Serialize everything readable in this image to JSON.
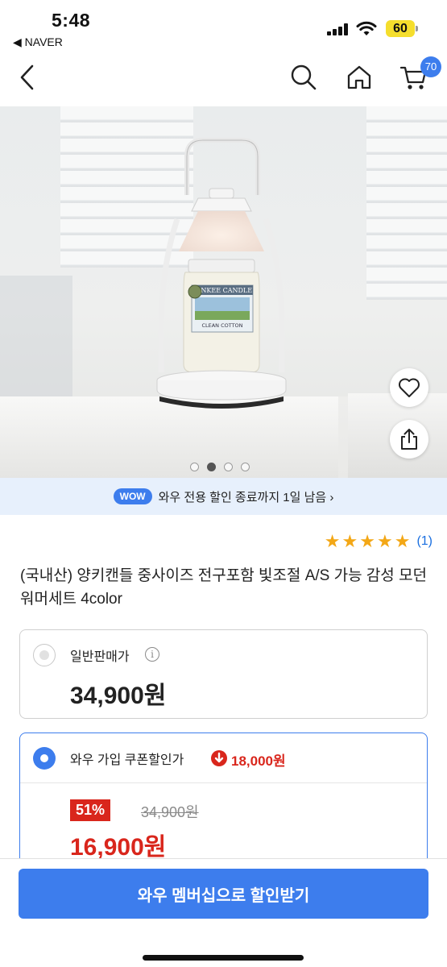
{
  "status_bar": {
    "time": "5:48",
    "back_app": "◀ NAVER",
    "battery": "60",
    "battery_color": "#f5de2d"
  },
  "nav": {
    "icons": [
      "back-icon",
      "search-icon",
      "home-icon",
      "cart-icon"
    ],
    "cart_count": "70"
  },
  "gallery": {
    "page_count": 4,
    "active_page": 2,
    "image_text": [
      "YANKEE CANDLE",
      "CLEAN COTTON"
    ]
  },
  "wow_banner": {
    "badge": "WOW",
    "text": "와우 전용 할인 종료까지 1일 남음 ›"
  },
  "rating": {
    "stars": 5,
    "count": "(1)"
  },
  "product": {
    "title": "(국내산) 양키캔들 중사이즈 전구포함 빛조절 A/S 가능 감성 모던 워머세트 4color"
  },
  "options": {
    "normal": {
      "label": "일반판매가",
      "info": "i",
      "price": "34,900원",
      "selected": false
    },
    "wow": {
      "label": "와우 가입 쿠폰할인가",
      "coupon_discount": "18,000원",
      "discount_rate": "51%",
      "original_price": "34,900원",
      "sale_price": "16,900원",
      "selected": true
    }
  },
  "cta": {
    "label": "와우 멤버십으로 할인받기"
  },
  "colors": {
    "accent": "#3d7ded",
    "sale": "#d9261c",
    "star": "#f3a716",
    "banner_bg": "#e7f0fc"
  }
}
